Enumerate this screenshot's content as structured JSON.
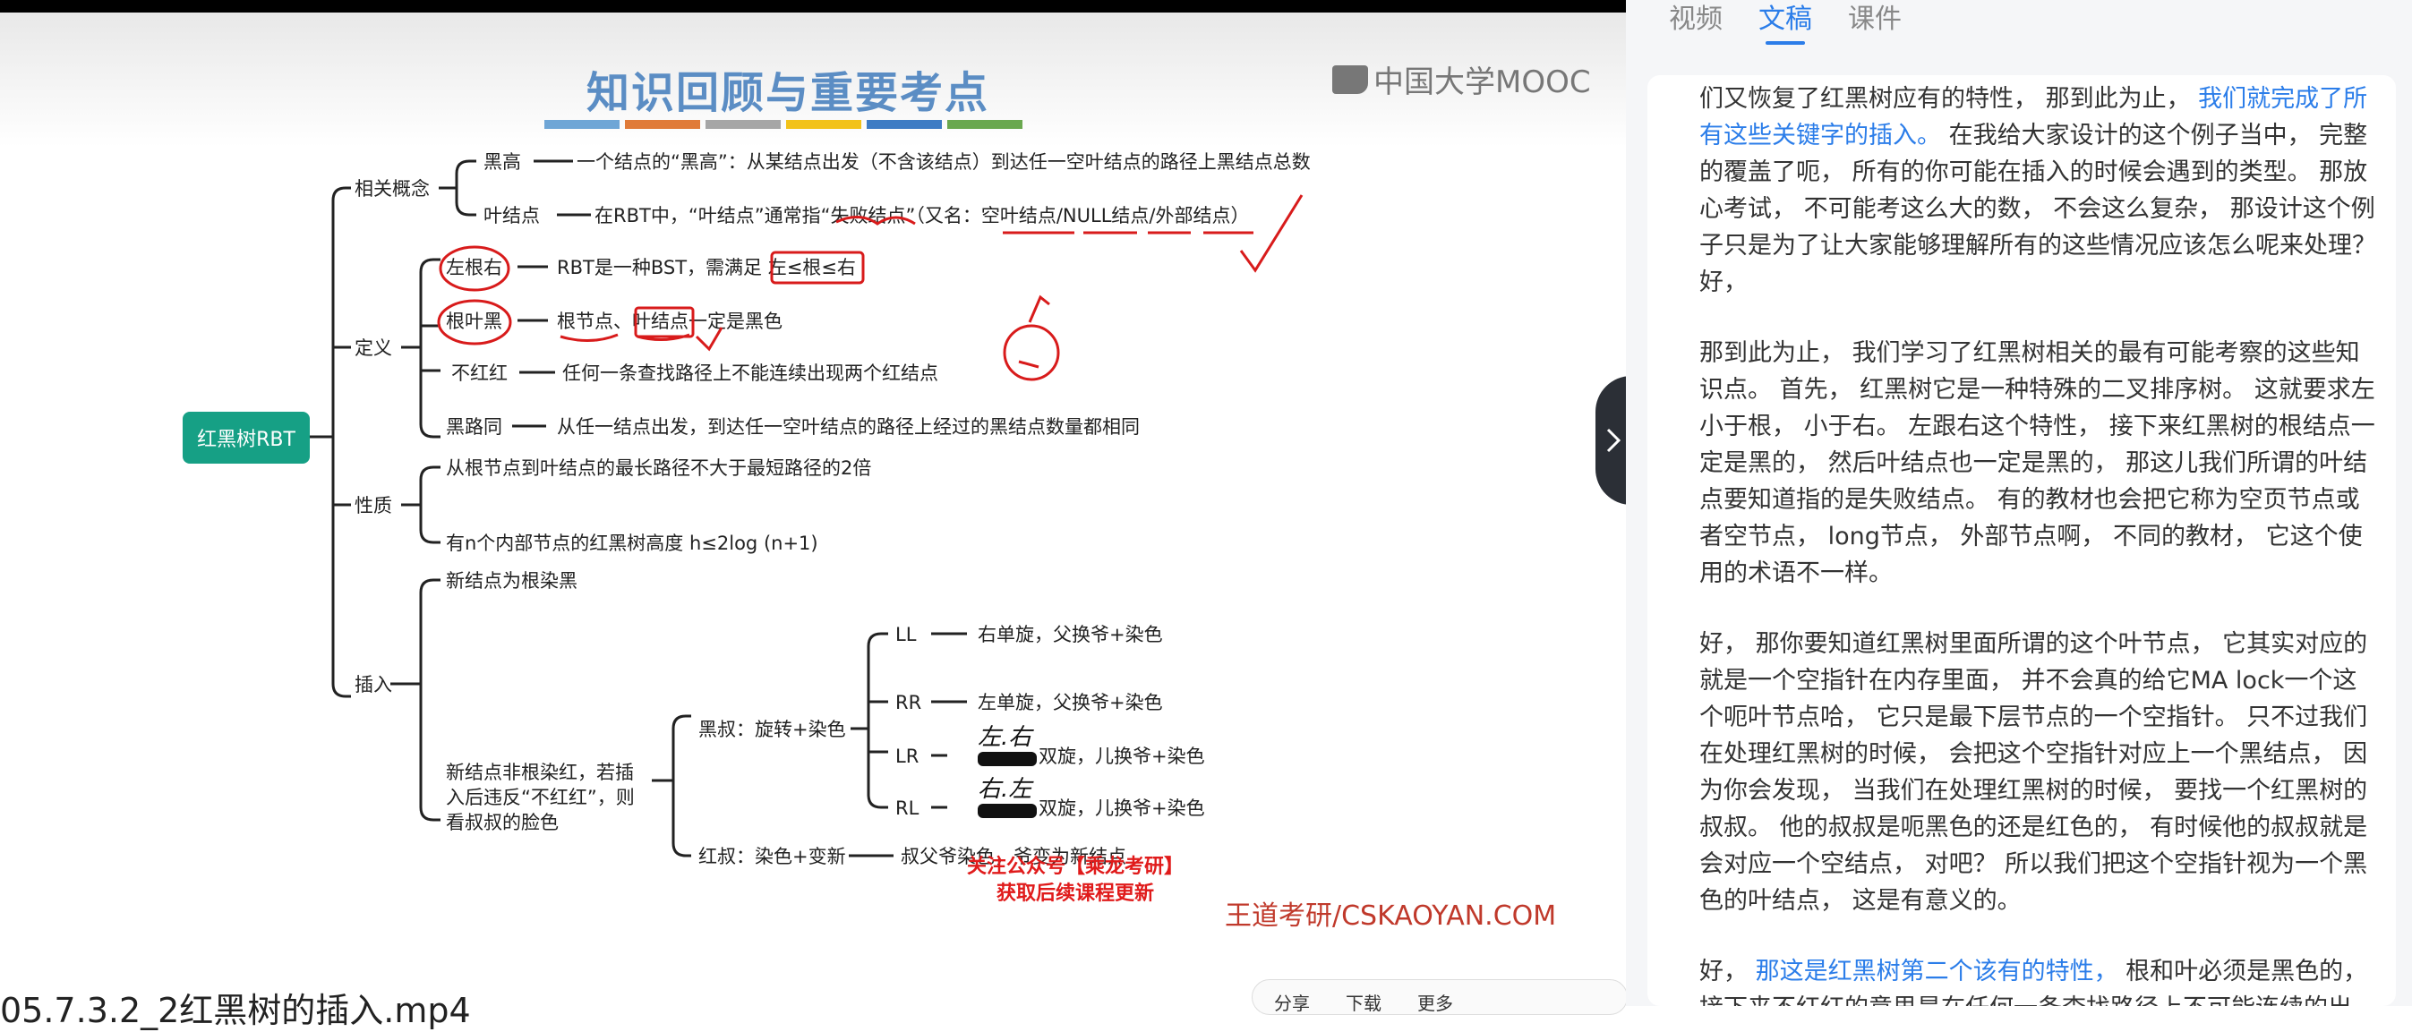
{
  "slide": {
    "title": "知识回顾与重要考点",
    "color_bar": [
      "#6fa6d6",
      "#e07b39",
      "#a6a6a6",
      "#f2c21a",
      "#3e7cc4",
      "#6aa84f"
    ],
    "logo": "中国大学MOOC",
    "root": "红黑树RBT",
    "groups": {
      "concepts": "相关概念",
      "definition": "定义",
      "properties": "性质",
      "insertion": "插入"
    },
    "concepts": {
      "black_height_label": "黑高",
      "black_height_text": "一个结点的“黑高”：从某结点出发（不含该结点）到达任一空叶结点的路径上黑结点总数",
      "leaf_label": "叶结点",
      "leaf_text": "在RBT中，“叶结点”通常指“失败结点”（又名：空叶结点/NULL结点/外部结点）"
    },
    "definition": {
      "d1_label": "左根右",
      "d1_text": "RBT是一种BST，需满足 左≤根≤右",
      "d2_label": "根叶黑",
      "d2_text": "根节点、叶结点一定是黑色",
      "d3_label": "不红红",
      "d3_text": "任何一条查找路径上不能连续出现两个红结点",
      "d4_label": "黑路同",
      "d4_text": "从任一结点出发，到达任一空叶结点的路径上经过的黑结点数量都相同"
    },
    "properties": {
      "p1": "从根节点到叶结点的最长路径不大于最短路径的2倍",
      "p2": "有n个内部节点的红黑树高度 h≤2log (n+1)"
    },
    "insertion": {
      "i1": "新结点为根染黑",
      "i2_line1": "新结点非根染红，若插",
      "i2_line2": "入后违反“不红红”，则",
      "i2_line3": "看叔叔的脸色",
      "black_uncle": "黑叔：旋转+染色",
      "red_uncle": "红叔：染色+变新",
      "red_uncle_text": "叔父爷染色，爷变为新结点",
      "ll": "LL",
      "ll_text": "右单旋，父换爷+染色",
      "rr": "RR",
      "rr_text": "左单旋，父换爷+染色",
      "lr": "LR",
      "lr_text": "双旋，儿换爷+染色",
      "rl": "RL",
      "rl_text": "双旋，儿换爷+染色",
      "lr_note": "左.右",
      "rl_note": "右.左"
    },
    "watermark_red_1": "关注公众号【乘龙考研】",
    "watermark_red_2": "获取后续课程更新",
    "watermark_site": "王道考研/CSKAOYAN.COM"
  },
  "video": {
    "name": "05.7.3.2_2红黑树的插入.mp4",
    "actions": [
      "分享",
      "下载",
      "更多"
    ]
  },
  "panel": {
    "tabs": [
      "视频",
      "文稿",
      "课件"
    ],
    "active_tab": "文稿",
    "paragraphs": [
      {
        "pre": "们又恢复了红黑树应有的特性， 那到此为止， ",
        "hl": "我们就完成了所有这些关键字的插入。",
        "post": " 在我给大家设计的这个例子当中， 完整的覆盖了呃， 所有的你可能在插入的时候会遇到的类型。 那放心考试， 不可能考这么大的数， 不会这么复杂， 那设计这个例子只是为了让大家能够理解所有的这些情况应该怎么呢来处理？ 好，"
      },
      {
        "pre": "那到此为止， 我们学习了红黑树相关的最有可能考察的这些知识点。 首先， 红黑树它是一种特殊的二叉排序树。 这就要求左小于根， 小于右。 左跟右这个特性， 接下来红黑树的根结点一定是黑的， 然后叶结点也一定是黑的， 那这儿我们所谓的叶结点要知道指的是失败结点。 有的教材也会把它称为空页节点或者空节点， long节点， 外部节点啊， 不同的教材， 它这个使用的术语不一样。",
        "hl": "",
        "post": ""
      },
      {
        "pre": "好， 那你要知道红黑树里面所谓的这个叶节点， 它其实对应的就是一个空指针在内存里面， 并不会真的给它MA lock一个这个呃叶节点哈， 它只是最下层节点的一个空指针。 只不过我们在处理红黑树的时候， 会把这个空指针对应上一个黑结点， 因为你会发现， 当我们在处理红黑树的时候， 要找一个红黑树的叔叔。 他的叔叔是呃黑色的还是红色的， 有时候他的叔叔就是会对应一个空结点， 对吧？ 所以我们把这个空指针视为一个黑色的叶结点， 这是有意义的。",
        "hl": "",
        "post": ""
      },
      {
        "pre": "好， ",
        "hl": "那这是红黑树第二个该有的特性，",
        "post": " 根和叶必须是黑色的， 接下来不红红的意思是在任何一条查找路径上不可能连续的出"
      }
    ]
  }
}
